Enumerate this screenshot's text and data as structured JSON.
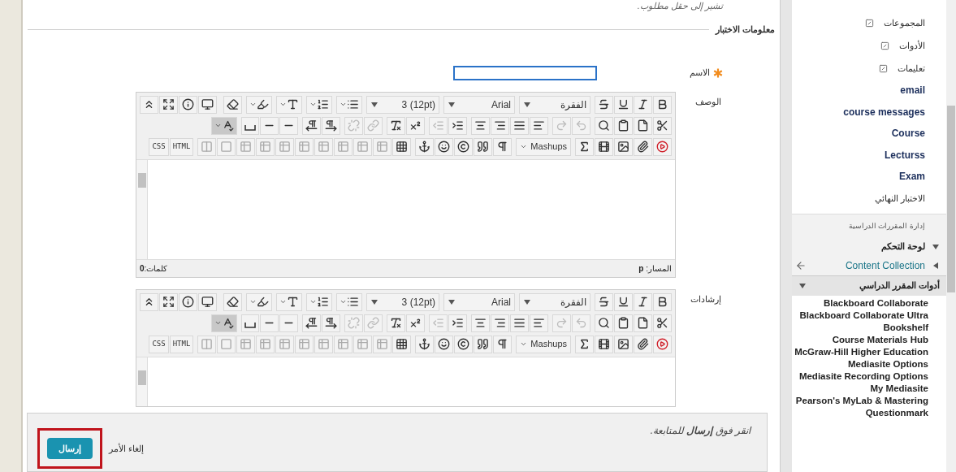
{
  "header_note": "تشير إلى حقل مطلوب.",
  "section_title": "معلومات الاختبار",
  "name_field": {
    "label": "الاسم",
    "required": true
  },
  "editors": [
    {
      "label": "الوصف",
      "toolbar": {
        "format": "الفقرة",
        "font": "Arial",
        "size": "(12pt) 3",
        "mashups": "Mashups",
        "css": "CSS",
        "html": "HTML"
      },
      "status": {
        "words": "كلمات:**0**",
        "path": "المسار: **p**"
      }
    },
    {
      "label": "إرشادات",
      "toolbar": {
        "format": "الفقرة",
        "font": "Arial",
        "size": "(12pt) 3",
        "mashups": "Mashups",
        "css": "CSS",
        "html": "HTML"
      }
    }
  ],
  "footer": {
    "hint": "انقر فوق **إرسال** للمتابعة.",
    "cancel": "إلغاء الأمر",
    "submit": "إرسال",
    "submit_highlighted": true
  },
  "sidebar": {
    "items": [
      {
        "kind": "hidden",
        "label": "المجموعات"
      },
      {
        "kind": "hidden",
        "label": "الأدوات"
      },
      {
        "kind": "hidden",
        "label": "تعليمات"
      },
      {
        "kind": "link",
        "label": "email"
      },
      {
        "kind": "link",
        "label": "course messages"
      },
      {
        "kind": "link",
        "label": "Course"
      },
      {
        "kind": "link",
        "label": "Lecturss"
      },
      {
        "kind": "link",
        "label": "Exam"
      },
      {
        "kind": "plain",
        "label": "الاختبار النهائي"
      }
    ],
    "management_title": "إدارة المقررات الدراسية",
    "sections": [
      {
        "kind": "menu",
        "label": "لوحة التحكم"
      },
      {
        "kind": "link",
        "label": "Content Collection"
      },
      {
        "kind": "open",
        "label": "أدوات المقرر الدراسي"
      }
    ],
    "tools": [
      "Blackboard Collaborate",
      "Blackboard Collaborate Ultra",
      "Bookshelf",
      "Course Materials Hub",
      "McGraw-Hill Higher Education",
      "Mediasite Options",
      "Mediasite Recording Options",
      "My Mediasite",
      "Pearson's MyLab & Mastering",
      "Questionmark"
    ]
  }
}
